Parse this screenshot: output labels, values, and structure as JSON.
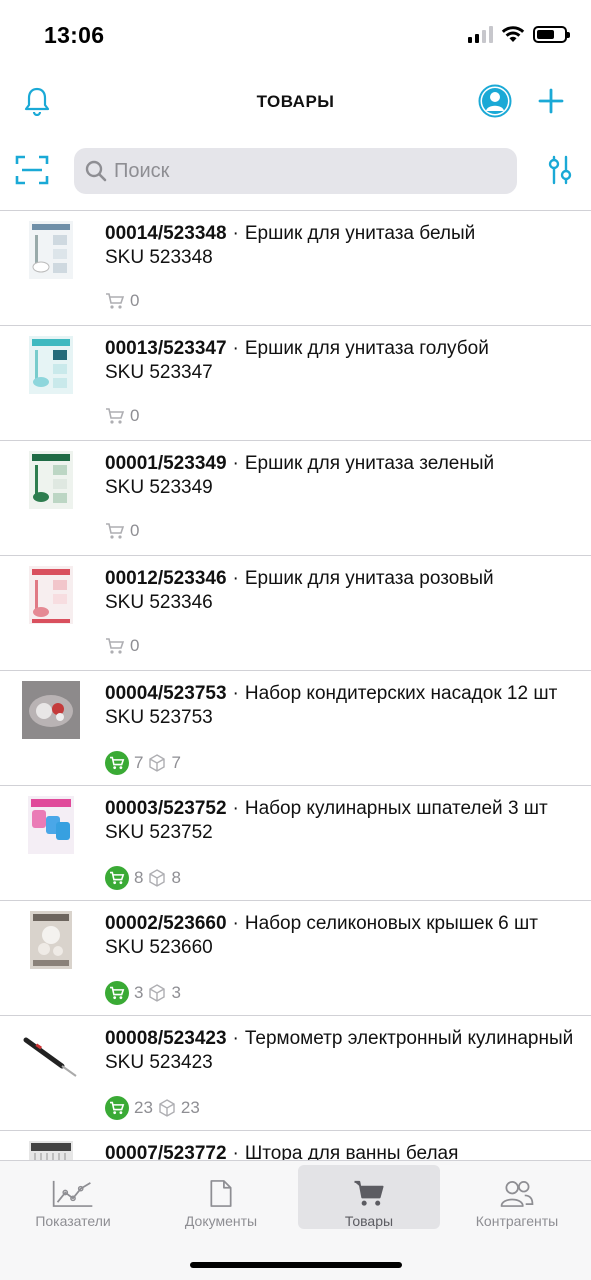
{
  "status_bar": {
    "time": "13:06"
  },
  "header": {
    "title": "ТОВАРЫ"
  },
  "search": {
    "placeholder": "Поиск"
  },
  "products": [
    {
      "code": "00014/523348",
      "name": "Ершик для унитаза белый",
      "sku": "SKU 523348",
      "cart": "0",
      "stock": "",
      "thumb": "white"
    },
    {
      "code": "00013/523347",
      "name": "Ершик для унитаза голубой",
      "sku": "SKU 523347",
      "cart": "0",
      "stock": "",
      "thumb": "blue"
    },
    {
      "code": "00001/523349",
      "name": "Ершик для унитаза зеленый",
      "sku": "SKU 523349",
      "cart": "0",
      "stock": "",
      "thumb": "green"
    },
    {
      "code": "00012/523346",
      "name": "Ершик для унитаза розовый",
      "sku": "SKU 523346",
      "cart": "0",
      "stock": "",
      "thumb": "pink"
    },
    {
      "code": "00004/523753",
      "name": "Набор кондитерских насадок 12 шт",
      "sku": "SKU 523753",
      "cart": "7",
      "stock": "7",
      "thumb": "nozzles"
    },
    {
      "code": "00003/523752",
      "name": "Набор кулинарных шпателей 3 шт",
      "sku": "SKU 523752",
      "cart": "8",
      "stock": "8",
      "thumb": "spatulas"
    },
    {
      "code": "00002/523660",
      "name": "Набор селиконовых крышек 6 шт",
      "sku": "SKU 523660",
      "cart": "3",
      "stock": "3",
      "thumb": "lids"
    },
    {
      "code": "00008/523423",
      "name": "Термометр электронный кулинарный",
      "sku": "SKU 523423",
      "cart": "23",
      "stock": "23",
      "thumb": "thermometer"
    },
    {
      "code": "00007/523772",
      "name": "Штора для ванны белая",
      "sku": "",
      "cart": "",
      "stock": "",
      "thumb": "curtain"
    }
  ],
  "tabs": [
    {
      "label": "Показатели",
      "icon": "chart-icon",
      "active": false
    },
    {
      "label": "Документы",
      "icon": "document-icon",
      "active": false
    },
    {
      "label": "Товары",
      "icon": "cart-icon",
      "active": true
    },
    {
      "label": "Контрагенты",
      "icon": "people-icon",
      "active": false
    }
  ],
  "colors": {
    "accent": "#1aa9d6",
    "cart_badge": "#3aaa35",
    "muted": "#8e8e93"
  }
}
